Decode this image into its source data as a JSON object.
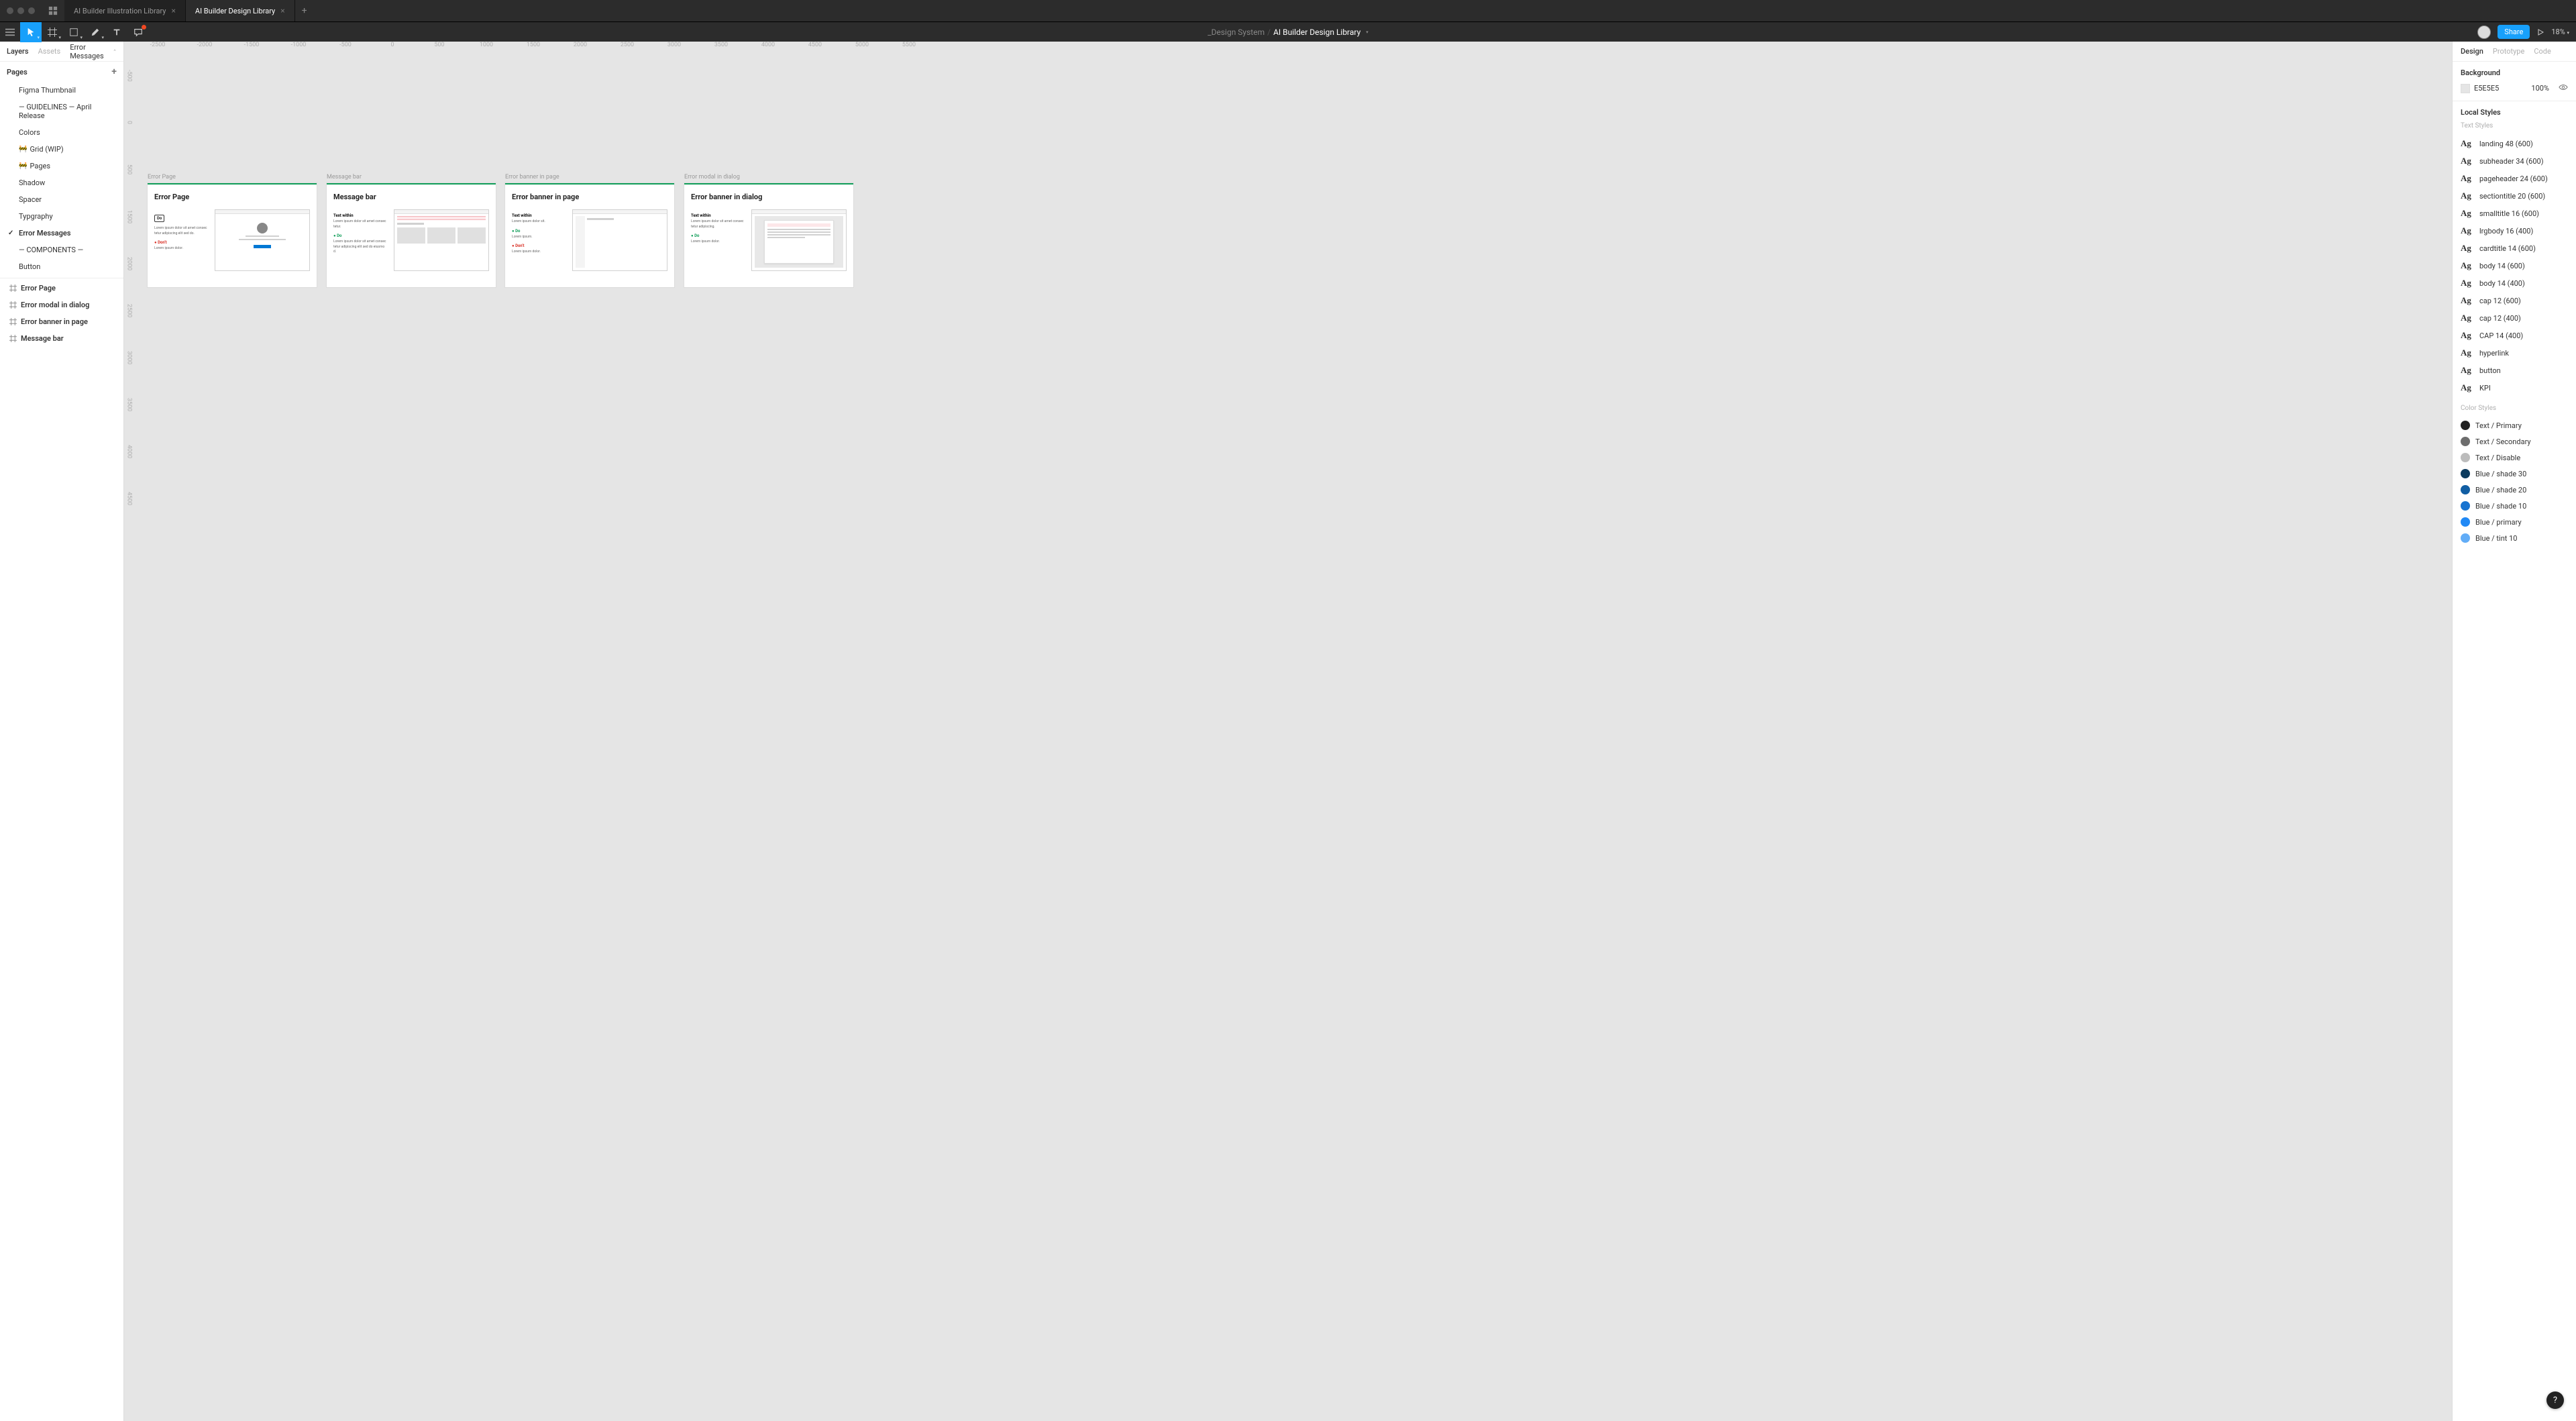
{
  "titlebar": {
    "tabs": [
      {
        "label": "AI Builder Illustration Library",
        "active": false
      },
      {
        "label": "AI Builder Design Library",
        "active": true
      }
    ]
  },
  "toolbar": {
    "breadcrumb1": "_Design System",
    "breadcrumb2": "AI Builder Design Library",
    "share": "Share",
    "zoom": "18%"
  },
  "left": {
    "tabs": {
      "layers": "Layers",
      "assets": "Assets",
      "crumb": "Error Messages"
    },
    "pagesHeader": "Pages",
    "pages": [
      {
        "label": "Figma Thumbnail",
        "wip": false,
        "sel": false
      },
      {
        "label": "— GUIDELINES — April Release",
        "wip": false,
        "sel": false
      },
      {
        "label": "Colors",
        "wip": false,
        "sel": false
      },
      {
        "label": "Grid (WIP)",
        "wip": true,
        "sel": false
      },
      {
        "label": "Pages",
        "wip": true,
        "sel": false
      },
      {
        "label": "Shadow",
        "wip": false,
        "sel": false
      },
      {
        "label": "Spacer",
        "wip": false,
        "sel": false
      },
      {
        "label": "Typgraphy",
        "wip": false,
        "sel": false
      },
      {
        "label": "Error Messages",
        "wip": false,
        "sel": true,
        "check": true
      },
      {
        "label": "— COMPONENTS —",
        "wip": false,
        "sel": false
      },
      {
        "label": "Button",
        "wip": false,
        "sel": false
      }
    ],
    "layers": [
      {
        "label": "Error Page"
      },
      {
        "label": "Error modal in dialog"
      },
      {
        "label": "Error banner in page"
      },
      {
        "label": "Message bar"
      }
    ]
  },
  "canvas": {
    "hruler": [
      "-2500",
      "-2000",
      "-1500",
      "-1000",
      "-500",
      "0",
      "500",
      "1000",
      "1500",
      "2000",
      "2500",
      "3000",
      "3500",
      "4000",
      "4500",
      "5000",
      "5500"
    ],
    "vruler": [
      "-500",
      "0",
      "500",
      "1500",
      "2000",
      "2500",
      "3000",
      "3500",
      "4000",
      "4500"
    ],
    "frames": [
      {
        "label": "Error Page",
        "title": "Error Page"
      },
      {
        "label": "Message bar",
        "title": "Message bar"
      },
      {
        "label": "Error banner in page",
        "title": "Error banner in page"
      },
      {
        "label": "Error modal in dialog",
        "title": "Error banner in dialog"
      }
    ]
  },
  "right": {
    "tabs": {
      "design": "Design",
      "prototype": "Prototype",
      "code": "Code"
    },
    "bgHeader": "Background",
    "bgHex": "E5E5E5",
    "bgOpacity": "100%",
    "localStyles": "Local Styles",
    "textStyles": "Text Styles",
    "ts": [
      "landing 48 (600)",
      "subheader 34 (600)",
      "pageheader 24 (600)",
      "sectiontitle 20 (600)",
      "smalltitle 16 (600)",
      "lrgbody 16 (400)",
      "cardtitle 14 (600)",
      "body 14 (600)",
      "body 14 (400)",
      "cap 12 (600)",
      "cap 12 (400)",
      "CAP 14 (400)",
      "hyperlink",
      "button",
      "KPI"
    ],
    "colorStyles": "Color Styles",
    "cs": [
      {
        "label": "Text / Primary",
        "c": "#222222"
      },
      {
        "label": "Text / Secondary",
        "c": "#6d6d6d"
      },
      {
        "label": "Text / Disable",
        "c": "#bcbcbc"
      },
      {
        "label": "Blue / shade 30",
        "c": "#0c3b5e"
      },
      {
        "label": "Blue / shade 20",
        "c": "#115ea3"
      },
      {
        "label": "Blue / shade 10",
        "c": "#1874d0"
      },
      {
        "label": "Blue / primary",
        "c": "#2189f5"
      },
      {
        "label": "Blue / tint 10",
        "c": "#62adf7"
      }
    ]
  },
  "helpFab": "?"
}
